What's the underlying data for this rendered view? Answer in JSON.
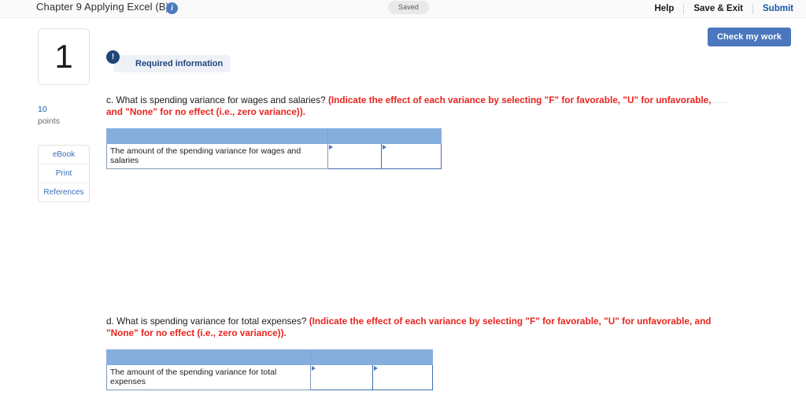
{
  "topbar": {
    "title": "Chapter 9 Applying Excel (B)",
    "info_icon": "info-icon",
    "saved_badge": "Saved",
    "help_label": "Help",
    "save_exit_label": "Save & Exit",
    "submit_label": "Submit"
  },
  "check_my_work": {
    "label": "Check my work",
    "color": "#4a77bd"
  },
  "rail": {
    "question_number": "1",
    "points_value": "10",
    "points_label": "points",
    "links": [
      {
        "label": "eBook"
      },
      {
        "label": "Print"
      },
      {
        "label": "References"
      }
    ]
  },
  "required_notice": {
    "badge_icon": "!",
    "label": "Required information"
  },
  "questions": [
    {
      "id": "c",
      "prompt": "c. What is spending variance for wages and salaries? ",
      "hint": "(Indicate the effect of each variance by selecting \"F\" for favorable, \"U\" for unfavorable, and \"None\" for no effect (i.e., zero variance)).",
      "table": {
        "header": [
          "",
          "",
          ""
        ],
        "row_label": "The amount of the spending variance for wages and salaries",
        "inputs": [
          "",
          ""
        ],
        "label_width": 281,
        "cell1_width": 68,
        "cell2_width": 76
      }
    },
    {
      "id": "d",
      "prompt": "d. What is spending variance for total expenses? ",
      "hint": "(Indicate the effect of each variance by selecting \"F\" for favorable, \"U\" for unfavorable, and \"None\" for no effect (i.e., zero variance)).",
      "table": {
        "header": [
          "",
          "",
          ""
        ],
        "row_label": "The amount of the spending variance for total expenses",
        "inputs": [
          "",
          ""
        ],
        "label_width": 259,
        "cell1_width": 79,
        "cell2_width": 76
      }
    }
  ],
  "colors": {
    "table_header_blue": "#85aedd",
    "cell_border_blue": "#3f6fae",
    "hint_red": "#e8251f",
    "link_blue": "#3b6fba",
    "notice_blue": "#1f4679"
  }
}
